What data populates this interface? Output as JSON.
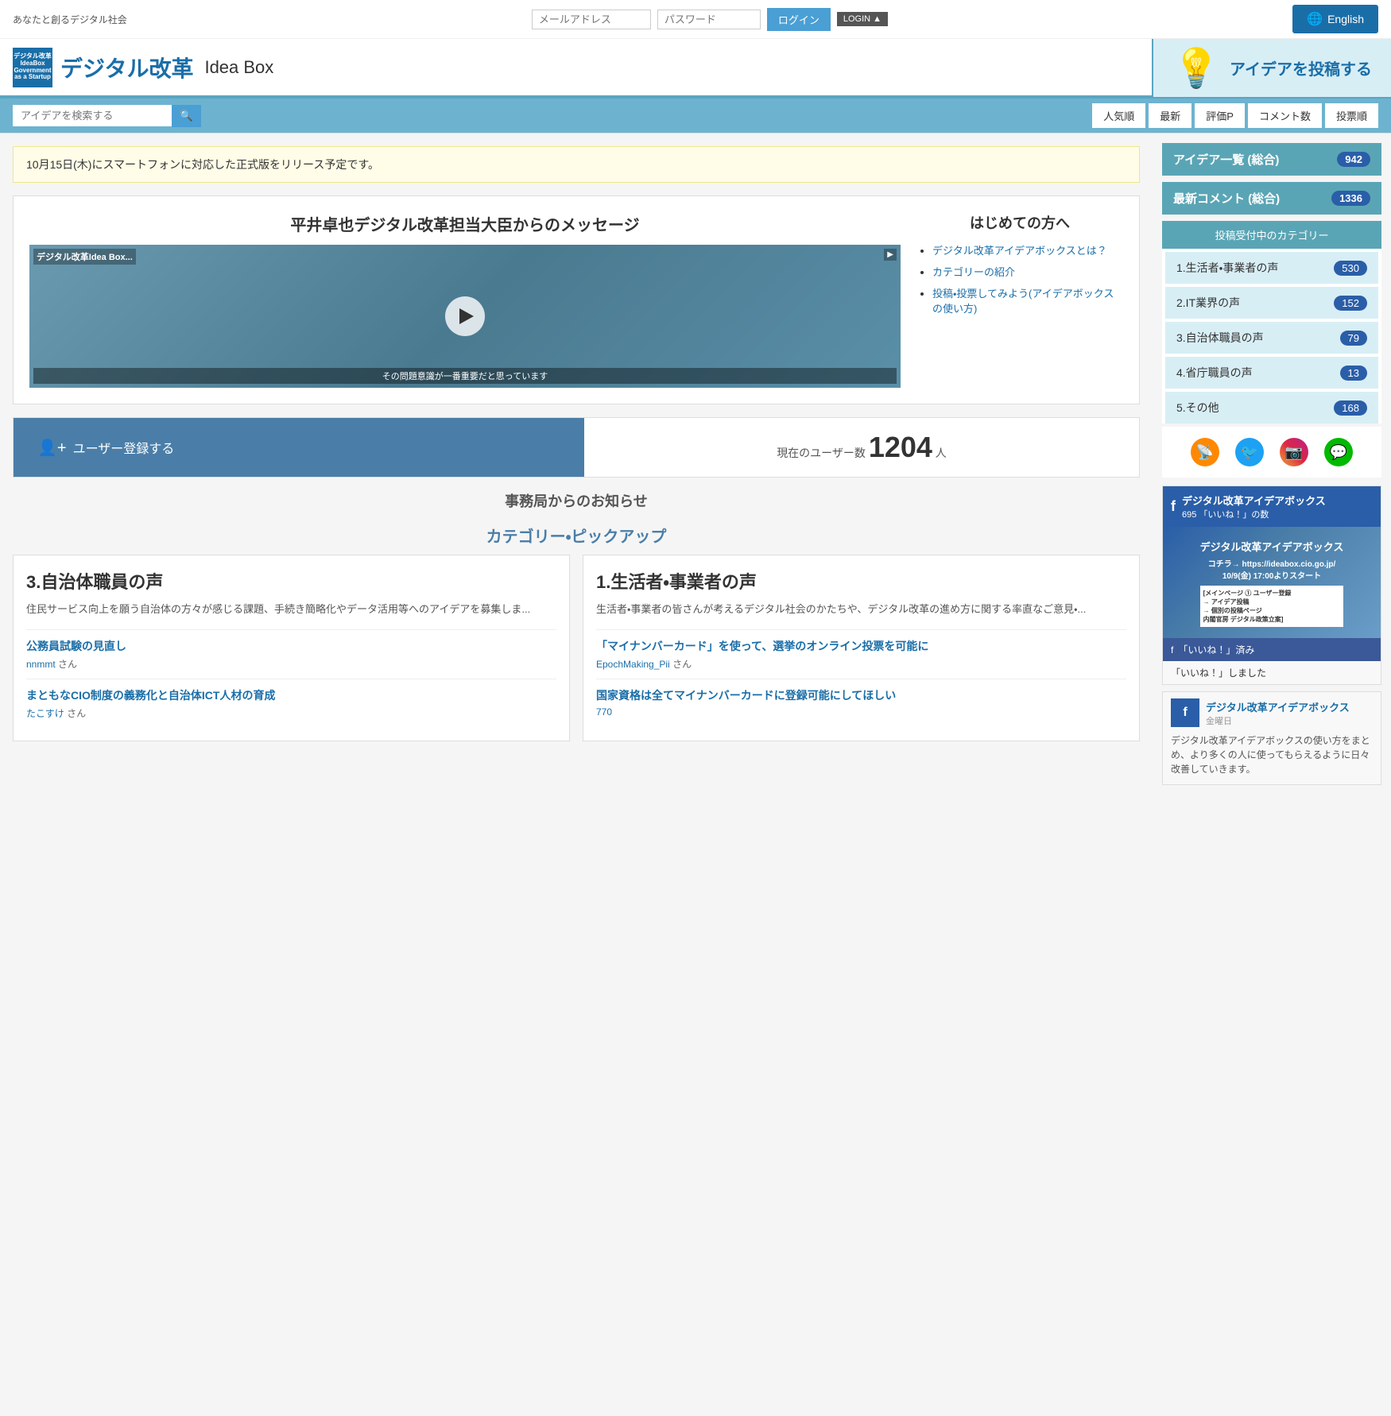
{
  "site": {
    "tagline": "あなたと創るデジタル社会",
    "logo_text": "デジタル改革",
    "logo_sub": "Idea Box",
    "logo_small": "デジタル改革\nIdeaBox\nGovernment\nas a Startup"
  },
  "header": {
    "email_placeholder": "メールアドレス",
    "password_placeholder": "パスワード",
    "login_btn": "ログイン",
    "login_dropdown": "LOGIN ▲",
    "english_btn": "English"
  },
  "nav": {
    "search_placeholder": "アイデアを検索する",
    "sort_buttons": [
      "人気順",
      "最新",
      "評価P",
      "コメント数",
      "投票順"
    ],
    "post_idea_btn": "アイデアを投稿する"
  },
  "announcement": {
    "text": "10月15日(木)にスマートフォンに対応した正式版をリリース予定です。"
  },
  "welcome": {
    "minister_title": "平井卓也デジタル改革担当大臣からのメッセージ",
    "video_caption": "その問題意識が一番重要だと思っています",
    "beginner_title": "はじめての方へ",
    "links": [
      {
        "text": "デジタル改革アイデアボックスとは？",
        "href": "#"
      },
      {
        "text": "カテゴリーの紹介",
        "href": "#"
      },
      {
        "text": "投稿・投票してみよう(アイデアボックスの使い方)",
        "href": "#"
      }
    ]
  },
  "register": {
    "btn_label": "ユーザー登録する",
    "user_count_label": "現在のユーザー数",
    "user_count": "1204",
    "user_count_unit": "人"
  },
  "office_notice": {
    "title": "事務局からのお知らせ"
  },
  "category_pickup": {
    "title": "カテゴリー・ピックアップ"
  },
  "categories_left": {
    "title": "3.自治体職員の声",
    "desc": "住民サービス向上を願う自治体の方々が感じる課題、手続き簡略化やデータ活用等へのアイデアを募集しま...",
    "ideas": [
      {
        "title": "公務員試験の見直し",
        "author": "nnmmt",
        "author_suffix": "さん"
      },
      {
        "title": "まともなCIO制度の義務化と自治体ICT人材の育成",
        "author": "たこすけ",
        "author_suffix": "さん"
      }
    ]
  },
  "categories_right": {
    "title": "1.生活者・事業者の声",
    "desc": "生活者・事業者の皆さんが考えるデジタル社会のかたちや、デジタル改革の進め方に関する率直なご意見・...",
    "ideas": [
      {
        "title": "「マイナンバーカード」を使って、選挙のオンライン投票を可能に",
        "author": "EpochMaking_Pii",
        "author_suffix": "さん"
      },
      {
        "title": "国家資格は全てマイナンバーカードに登録可能にしてほしい",
        "author": "770",
        "author_suffix": ""
      }
    ]
  },
  "sidebar": {
    "idea_list_label": "アイデア一覧 (総合)",
    "idea_list_count": "942",
    "comment_label": "最新コメント (総合)",
    "comment_count": "1336",
    "cat_section_label": "投稿受付中のカテゴリー",
    "categories": [
      {
        "label": "1.生活者・事業者の声",
        "count": "530"
      },
      {
        "label": "2.IT業界の声",
        "count": "152"
      },
      {
        "label": "3.自治体職員の声",
        "count": "79"
      },
      {
        "label": "4.省庁職員の声",
        "count": "13"
      },
      {
        "label": "5.その他",
        "count": "168"
      }
    ],
    "social": {
      "rss_label": "RSS",
      "twitter_label": "Twitter",
      "instagram_label": "Instagram",
      "line_label": "LINE"
    },
    "fb_like_header": "「いいね！」済み",
    "fb_liked_text": "「いいね！」しました",
    "fb_page_title": "デジタル改革アイデアボックス",
    "fb_page_subtitle": "695 「いいね！」の数",
    "fb_page_date": "10/9(金) 17:00よりスタート",
    "fb_post_title": "デジタル改革アイデアボックス",
    "fb_post_date": "金曜日",
    "fb_post_text": "デジタル改革アイデアボックスの使い方をまとめ、より多くの人に使ってもらえるように日々改善していきます。"
  }
}
